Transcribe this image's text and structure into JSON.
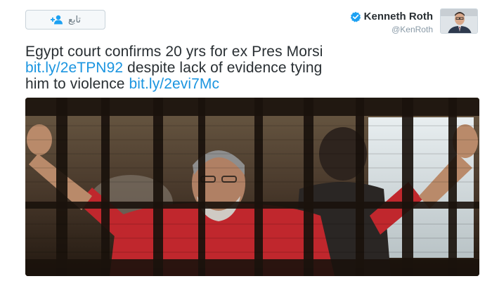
{
  "tweet": {
    "follow_button": {
      "label": "تابع",
      "icon": "add-user-icon"
    },
    "author": {
      "name": "Kenneth Roth",
      "handle": "@KenRoth",
      "verified_icon": "verified-badge-icon"
    },
    "text": {
      "line1": "Egypt court confirms 20 yrs for ex Pres Morsi",
      "link1": "bit.ly/2eTPN92",
      "line2": " despite lack of evidence tying",
      "line3": "him to violence ",
      "link2": "bit.ly/2evi7Mc"
    },
    "colors": {
      "link": "#1b95e0",
      "verified": "#1da1f2",
      "text": "#292f33",
      "handle": "#8899a6"
    }
  }
}
